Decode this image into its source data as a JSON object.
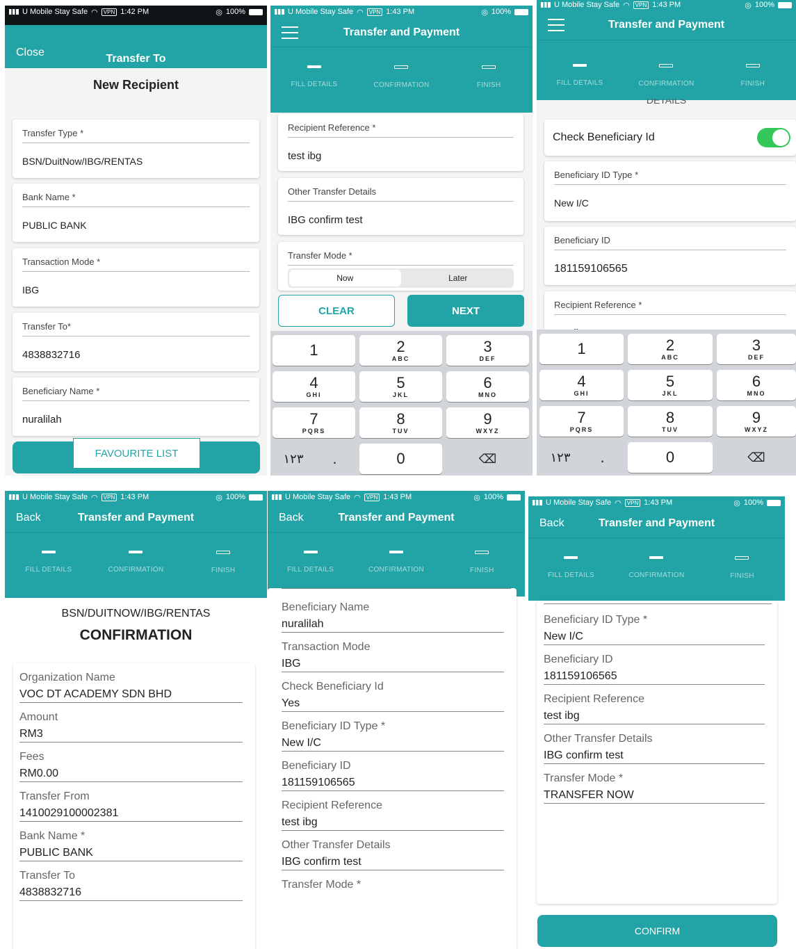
{
  "status": {
    "carrier": "U Mobile Stay Safe",
    "vpn": "VPN",
    "battery": "100%",
    "time1": "1:42 PM",
    "time2": "1:43 PM"
  },
  "steps": [
    "FILL DETAILS",
    "CONFIRMATION",
    "FINISH"
  ],
  "colors": {
    "accent": "#22a4a6",
    "toggle_on": "#34c759"
  },
  "p1": {
    "close": "Close",
    "title": "Transfer To",
    "heading": "New Recipient",
    "fields": [
      {
        "label": "Transfer Type *",
        "value": "BSN/DuitNow/IBG/RENTAS"
      },
      {
        "label": "Bank Name *",
        "value": "PUBLIC BANK"
      },
      {
        "label": "Transaction Mode *",
        "value": "IBG"
      },
      {
        "label": "Transfer To*",
        "value": "4838832716"
      },
      {
        "label": "Beneficiary Name *",
        "value": "nuralilah"
      }
    ],
    "favourite": "FAVOURITE LIST"
  },
  "p2": {
    "title": "Transfer and Payment",
    "fields": [
      {
        "label": "Recipient Reference *",
        "value": "test ibg"
      },
      {
        "label": "Other Transfer Details",
        "value": "IBG  confirm test"
      }
    ],
    "mode_label": "Transfer Mode *",
    "mode_now": "Now",
    "mode_later": "Later",
    "clear": "CLEAR",
    "next": "NEXT"
  },
  "keypad": {
    "keys": [
      {
        "d": "1",
        "l": ""
      },
      {
        "d": "2",
        "l": "ABC"
      },
      {
        "d": "3",
        "l": "DEF"
      },
      {
        "d": "4",
        "l": "GHI"
      },
      {
        "d": "5",
        "l": "JKL"
      },
      {
        "d": "6",
        "l": "MNO"
      },
      {
        "d": "7",
        "l": "PQRS"
      },
      {
        "d": "8",
        "l": "TUV"
      },
      {
        "d": "9",
        "l": "WXYZ"
      }
    ],
    "arabic": "١٢٣",
    "dot": ".",
    "zero": "0",
    "backspace": "⌫"
  },
  "p3": {
    "title": "Transfer and Payment",
    "cut_heading": "DETAILS",
    "check_label": "Check Beneficiary Id",
    "fields": [
      {
        "label": "Beneficiary ID Type *",
        "value": "New I/C"
      },
      {
        "label": "Beneficiary ID",
        "value": "181159106565"
      },
      {
        "label": "Recipient Reference *",
        "value": "test ibg"
      }
    ]
  },
  "p4": {
    "back": "Back",
    "title": "Transfer and Payment",
    "subtitle": "BSN/DUITNOW/IBG/RENTAS",
    "heading": "CONFIRMATION",
    "rows": [
      {
        "label": "Organization Name",
        "value": "VOC DT ACADEMY SDN BHD"
      },
      {
        "label": "Amount",
        "value": "RM3"
      },
      {
        "label": "Fees",
        "value": "RM0.00"
      },
      {
        "label": "Transfer From",
        "value": "1410029100002381"
      },
      {
        "label": "Bank Name *",
        "value": "PUBLIC BANK"
      },
      {
        "label": "Transfer To",
        "value": "4838832716"
      }
    ]
  },
  "p5": {
    "back": "Back",
    "title": "Transfer and Payment",
    "rows": [
      {
        "label": "Beneficiary Name",
        "value": "nuralilah"
      },
      {
        "label": "Transaction Mode",
        "value": "IBG"
      },
      {
        "label": "Check Beneficiary Id",
        "value": "Yes"
      },
      {
        "label": "Beneficiary ID Type *",
        "value": "New I/C"
      },
      {
        "label": "Beneficiary ID",
        "value": "181159106565"
      },
      {
        "label": "Recipient Reference",
        "value": "test ibg"
      },
      {
        "label": "Other Transfer Details",
        "value": "IBG  confirm test"
      },
      {
        "label": "Transfer Mode *",
        "value": ""
      }
    ]
  },
  "p6": {
    "back": "Back",
    "title": "Transfer and Payment",
    "rows": [
      {
        "label": "Beneficiary ID Type *",
        "value": "New I/C"
      },
      {
        "label": "Beneficiary ID",
        "value": "181159106565"
      },
      {
        "label": "Recipient Reference",
        "value": "test ibg"
      },
      {
        "label": "Other Transfer Details",
        "value": "IBG  confirm test"
      },
      {
        "label": "Transfer Mode *",
        "value": "TRANSFER NOW"
      }
    ],
    "confirm": "CONFIRM"
  }
}
